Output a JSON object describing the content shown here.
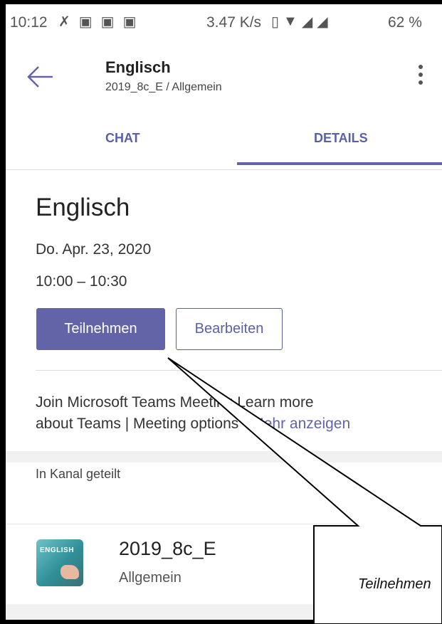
{
  "status_bar": {
    "time": "10:12",
    "network_speed": "3.47 K/s",
    "battery": "62 %"
  },
  "header": {
    "title": "Englisch",
    "subtitle": "2019_8c_E / Allgemein"
  },
  "tabs": [
    {
      "label": "CHAT",
      "active": false
    },
    {
      "label": "DETAILS",
      "active": true
    }
  ],
  "meeting": {
    "title": "Englisch",
    "date": "Do. Apr. 23, 2020",
    "time": "10:00 – 10:30",
    "join_label": "Teilnehmen",
    "edit_label": "Bearbeiten",
    "description_line1": "Join Microsoft Teams Meeting Learn more",
    "description_line2": "about Teams | Meeting options",
    "show_more": "Mehr anzeigen"
  },
  "shared": {
    "label": "In Kanal geteilt",
    "team": "2019_8c_E",
    "channel": "Allgemein",
    "thumb_text": "ENGLISH"
  },
  "callout": {
    "text": "Teilnehmen"
  },
  "colors": {
    "accent": "#6264a7"
  }
}
